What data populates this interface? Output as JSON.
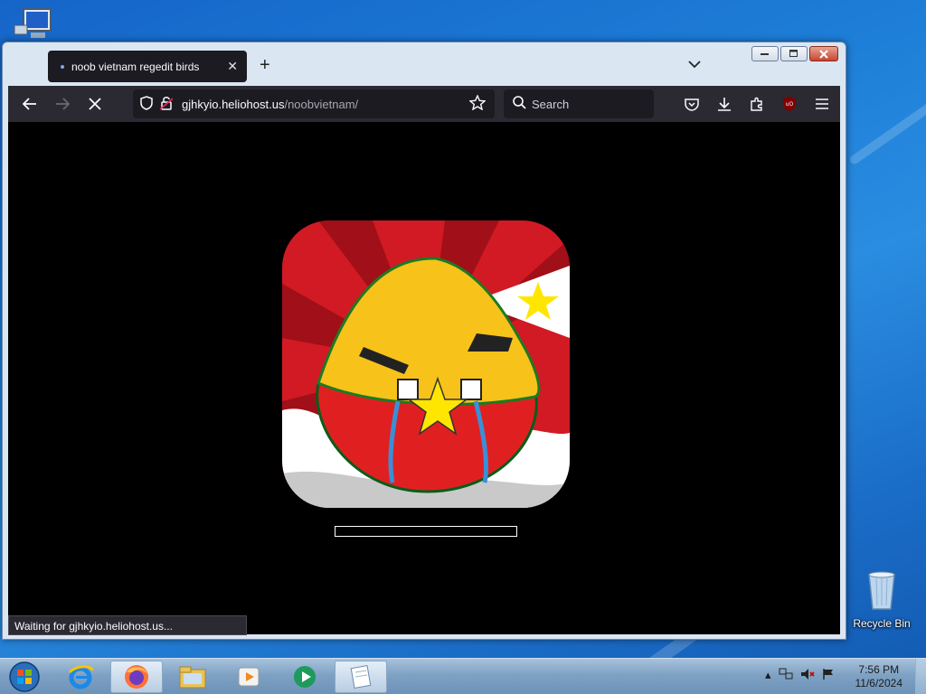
{
  "desktop": {
    "computer_icon": "computer-icon",
    "recycle_bin_label": "Recycle Bin"
  },
  "browser": {
    "tab_title": "noob vietnam regedit birds",
    "url_host": "gjhkyio.heliohost.us",
    "url_path": "/noobvietnam/",
    "search_placeholder": "Search",
    "status_text": "Waiting for gjhkyio.heliohost.us...",
    "loading_progress": 0
  },
  "taskbar": {
    "time": "7:56 PM",
    "date": "11/6/2024"
  }
}
